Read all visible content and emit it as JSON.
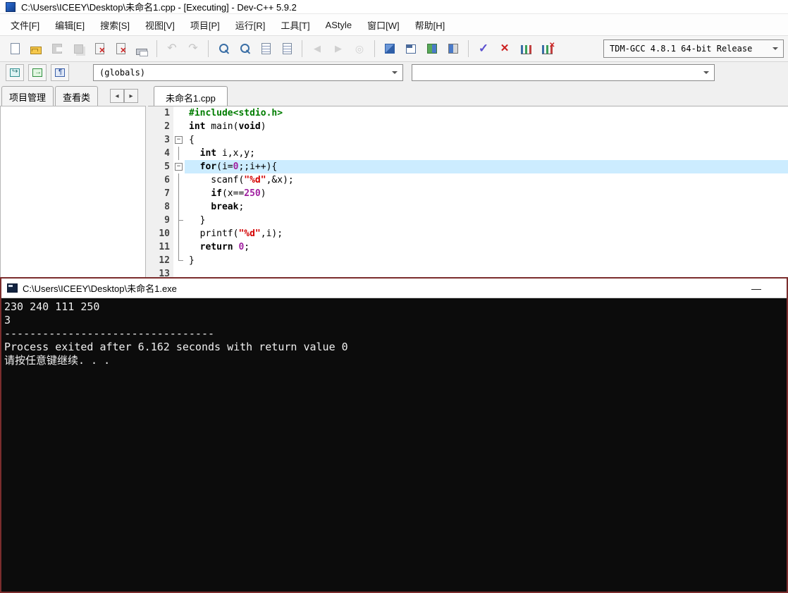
{
  "titlebar": {
    "title": "C:\\Users\\ICEEY\\Desktop\\未命名1.cpp - [Executing] - Dev-C++ 5.9.2"
  },
  "menubar": {
    "items": [
      {
        "label": "文件[F]"
      },
      {
        "label": "编辑[E]"
      },
      {
        "label": "搜索[S]"
      },
      {
        "label": "视图[V]"
      },
      {
        "label": "项目[P]"
      },
      {
        "label": "运行[R]"
      },
      {
        "label": "工具[T]"
      },
      {
        "label": "AStyle"
      },
      {
        "label": "窗口[W]"
      },
      {
        "label": "帮助[H]"
      }
    ]
  },
  "toolbar": {
    "compiler_select": "TDM-GCC 4.8.1 64-bit Release",
    "buttons": [
      {
        "name": "new-file-button",
        "icon": "new-file-icon",
        "type": "page",
        "disabled": false
      },
      {
        "name": "open-button",
        "icon": "open-folder-icon",
        "type": "folder",
        "disabled": false
      },
      {
        "name": "save-button",
        "icon": "save-icon",
        "type": "disk",
        "disabled": true
      },
      {
        "name": "save-all-button",
        "icon": "save-all-icon",
        "type": "disk2",
        "disabled": true
      },
      {
        "name": "close-button",
        "icon": "close-file-icon",
        "type": "closefile",
        "disabled": false
      },
      {
        "name": "close-all-button",
        "icon": "close-all-icon",
        "type": "closefile",
        "disabled": false
      },
      {
        "name": "print-button",
        "icon": "printer-icon",
        "type": "print",
        "disabled": false
      },
      {
        "type": "separator"
      },
      {
        "name": "undo-button",
        "icon": "undo-icon",
        "type": "undo",
        "disabled": true
      },
      {
        "name": "redo-button",
        "icon": "redo-icon",
        "type": "redo",
        "disabled": true
      },
      {
        "type": "separator"
      },
      {
        "name": "find-button",
        "icon": "search-icon",
        "type": "find",
        "disabled": false
      },
      {
        "name": "find-in-files-button",
        "icon": "search-files-icon",
        "type": "find",
        "disabled": false
      },
      {
        "name": "replace-button",
        "icon": "replace-icon",
        "type": "lines",
        "disabled": false
      },
      {
        "name": "goto-line-button",
        "icon": "goto-line-icon",
        "type": "lines",
        "disabled": false
      },
      {
        "type": "separator"
      },
      {
        "name": "back-button",
        "icon": "arrow-left-icon",
        "type": "arrow-left",
        "disabled": true
      },
      {
        "name": "forward-button",
        "icon": "arrow-right-icon",
        "type": "arrow-right",
        "disabled": true
      },
      {
        "name": "goto-bookmark-button",
        "icon": "bookmark-icon",
        "type": "bookmark",
        "disabled": true
      },
      {
        "type": "separator"
      },
      {
        "name": "compile-button",
        "icon": "compile-icon",
        "type": "grid-blue",
        "disabled": false
      },
      {
        "name": "run-button",
        "icon": "run-icon",
        "type": "window",
        "disabled": false
      },
      {
        "name": "compile-run-button",
        "icon": "compile-run-icon",
        "type": "grid-mix",
        "disabled": false
      },
      {
        "name": "rebuild-button",
        "icon": "rebuild-icon",
        "type": "grid-rebuild",
        "disabled": false
      },
      {
        "type": "separator"
      },
      {
        "name": "syntax-check-button",
        "icon": "check-icon",
        "type": "check",
        "disabled": false
      },
      {
        "name": "abort-button",
        "icon": "abort-icon",
        "type": "abort",
        "disabled": false
      },
      {
        "name": "profile-button",
        "icon": "chart-icon",
        "type": "chart",
        "disabled": false
      },
      {
        "name": "profile-delete-button",
        "icon": "chart-delete-icon",
        "type": "chart-del",
        "disabled": false
      }
    ]
  },
  "navbar": {
    "buttons": [
      {
        "name": "goto-declaration-button",
        "icon": "window-arrow-icon",
        "type": "nav1"
      },
      {
        "name": "goto-definition-button",
        "icon": "window-go-icon",
        "type": "nav2"
      },
      {
        "name": "class-browser-button",
        "icon": "window-bookmark-icon",
        "type": "nav3"
      }
    ],
    "globals_select": "(globals)",
    "members_select": ""
  },
  "sidebar": {
    "tabs": [
      {
        "label": "项目管理"
      },
      {
        "label": "查看类"
      }
    ],
    "scroll_left": "◂",
    "scroll_right": "▸"
  },
  "editor": {
    "tab": "未命名1.cpp",
    "highlight_line": 5,
    "lines": [
      {
        "n": 1,
        "fold": "none",
        "segs": [
          {
            "t": "#include<stdio.h>",
            "c": "pp"
          }
        ]
      },
      {
        "n": 2,
        "fold": "none",
        "segs": [
          {
            "t": "int",
            "c": "kw"
          },
          {
            "t": " main(",
            "c": "pl"
          },
          {
            "t": "void",
            "c": "kw"
          },
          {
            "t": ")",
            "c": "pl"
          }
        ]
      },
      {
        "n": 3,
        "fold": "box",
        "segs": [
          {
            "t": "{",
            "c": "pl"
          }
        ]
      },
      {
        "n": 4,
        "fold": "line",
        "segs": [
          {
            "t": "  ",
            "c": "pl"
          },
          {
            "t": "int",
            "c": "kw"
          },
          {
            "t": " i,x,y;",
            "c": "pl"
          }
        ]
      },
      {
        "n": 5,
        "fold": "box",
        "hl": true,
        "segs": [
          {
            "t": "  ",
            "c": "pl"
          },
          {
            "t": "for",
            "c": "kw"
          },
          {
            "t": "(i=",
            "c": "pl"
          },
          {
            "t": "0",
            "c": "num"
          },
          {
            "t": ";;i++){",
            "c": "pl"
          }
        ]
      },
      {
        "n": 6,
        "fold": "line",
        "segs": [
          {
            "t": "    scanf(",
            "c": "pl"
          },
          {
            "t": "\"%d\"",
            "c": "str"
          },
          {
            "t": ",&x);",
            "c": "pl"
          }
        ]
      },
      {
        "n": 7,
        "fold": "line",
        "segs": [
          {
            "t": "    ",
            "c": "pl"
          },
          {
            "t": "if",
            "c": "kw"
          },
          {
            "t": "(x==",
            "c": "pl"
          },
          {
            "t": "250",
            "c": "num"
          },
          {
            "t": ")",
            "c": "pl"
          }
        ]
      },
      {
        "n": 8,
        "fold": "line",
        "segs": [
          {
            "t": "    ",
            "c": "pl"
          },
          {
            "t": "break",
            "c": "kw"
          },
          {
            "t": ";",
            "c": "pl"
          }
        ]
      },
      {
        "n": 9,
        "fold": "tick",
        "segs": [
          {
            "t": "  }",
            "c": "pl"
          }
        ]
      },
      {
        "n": 10,
        "fold": "line",
        "segs": [
          {
            "t": "  printf(",
            "c": "pl"
          },
          {
            "t": "\"%d\"",
            "c": "str"
          },
          {
            "t": ",i);",
            "c": "pl"
          }
        ]
      },
      {
        "n": 11,
        "fold": "line",
        "segs": [
          {
            "t": "  ",
            "c": "pl"
          },
          {
            "t": "return",
            "c": "kw"
          },
          {
            "t": " ",
            "c": "pl"
          },
          {
            "t": "0",
            "c": "num"
          },
          {
            "t": ";",
            "c": "pl"
          }
        ]
      },
      {
        "n": 12,
        "fold": "end",
        "segs": [
          {
            "t": "}",
            "c": "pl"
          }
        ]
      },
      {
        "n": 13,
        "fold": "none",
        "segs": []
      }
    ]
  },
  "console": {
    "title": "C:\\Users\\ICEEY\\Desktop\\未命名1.exe",
    "minimize_label": "—",
    "lines": [
      "230 240 111 250",
      "3",
      "---------------------------------",
      "Process exited after 6.162 seconds with return value 0",
      "请按任意键继续. . ."
    ]
  }
}
